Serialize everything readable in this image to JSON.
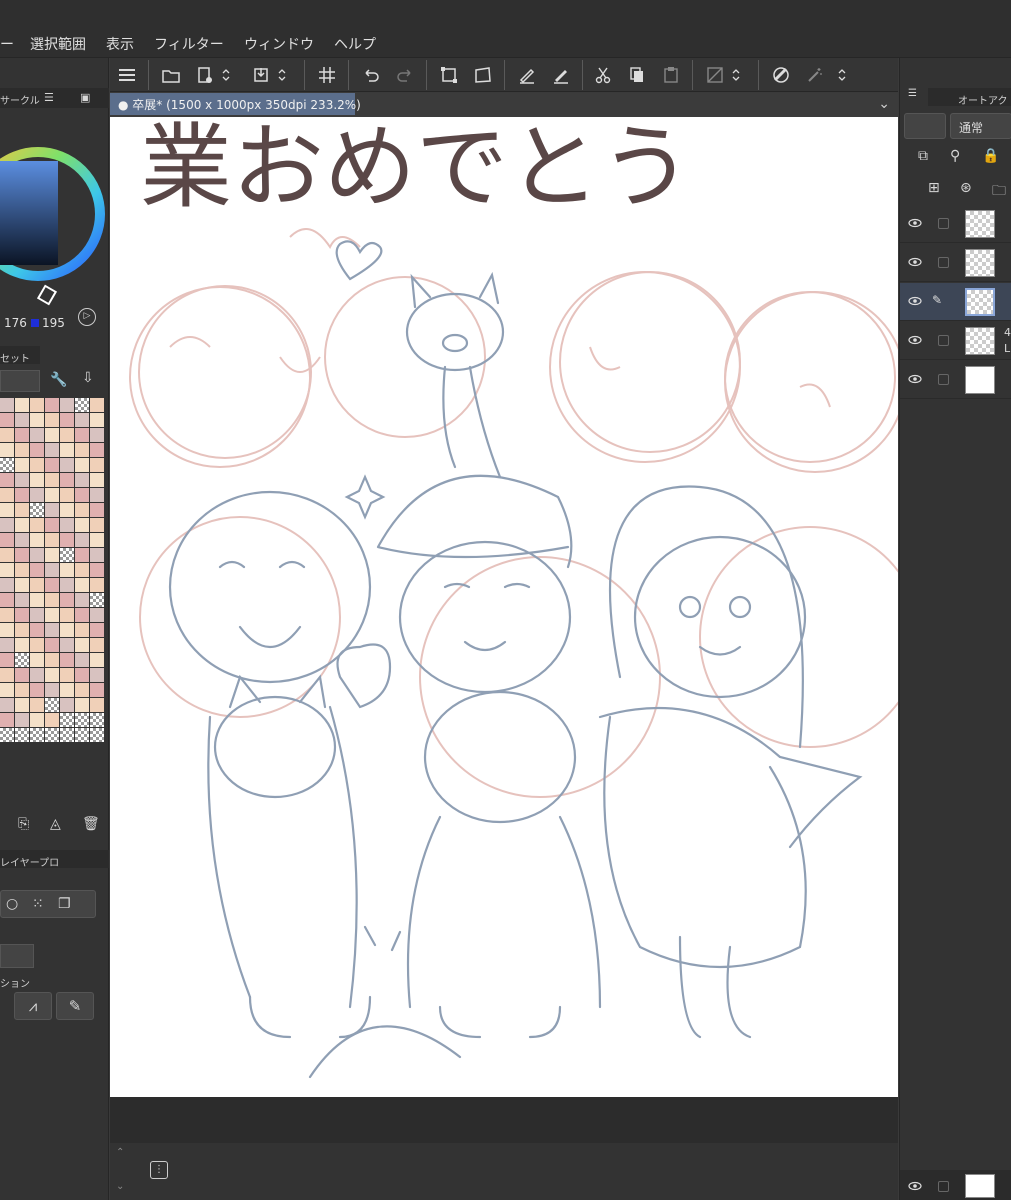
{
  "menu": {
    "items": [
      "ー",
      "選択範囲",
      "表示",
      "フィルター",
      "ウィンドウ",
      "ヘルプ"
    ]
  },
  "document": {
    "tab_label": "卒展* (1500 x 1000px 350dpi 233.2%)"
  },
  "left_panel": {
    "tab_color_circle": "サークル",
    "rgb_g": "176",
    "rgb_b": "195",
    "tab_color_set": "セット",
    "tab_layer_property": "レイヤープロ",
    "section_label": "ション"
  },
  "right_panel": {
    "tab_auto_action": "オートアク",
    "blend_mode": "通常",
    "layers": [
      {
        "visible": true,
        "editing": false,
        "thumb": "transparent"
      },
      {
        "visible": true,
        "editing": false,
        "thumb": "transparent"
      },
      {
        "visible": true,
        "editing": true,
        "thumb": "transparent"
      },
      {
        "visible": true,
        "editing": false,
        "thumb": "transparent",
        "label_top": "4",
        "label_bottom": "L"
      },
      {
        "visible": true,
        "editing": false,
        "thumb": "white"
      }
    ]
  },
  "canvas": {
    "headline_text": "業おめでとう"
  },
  "colors": {
    "accent_tab": "#5b6e8c",
    "sketch_blue": "#8f9fb4",
    "sketch_pink": "#e6c2bd",
    "headline_brown": "#5a4747"
  }
}
